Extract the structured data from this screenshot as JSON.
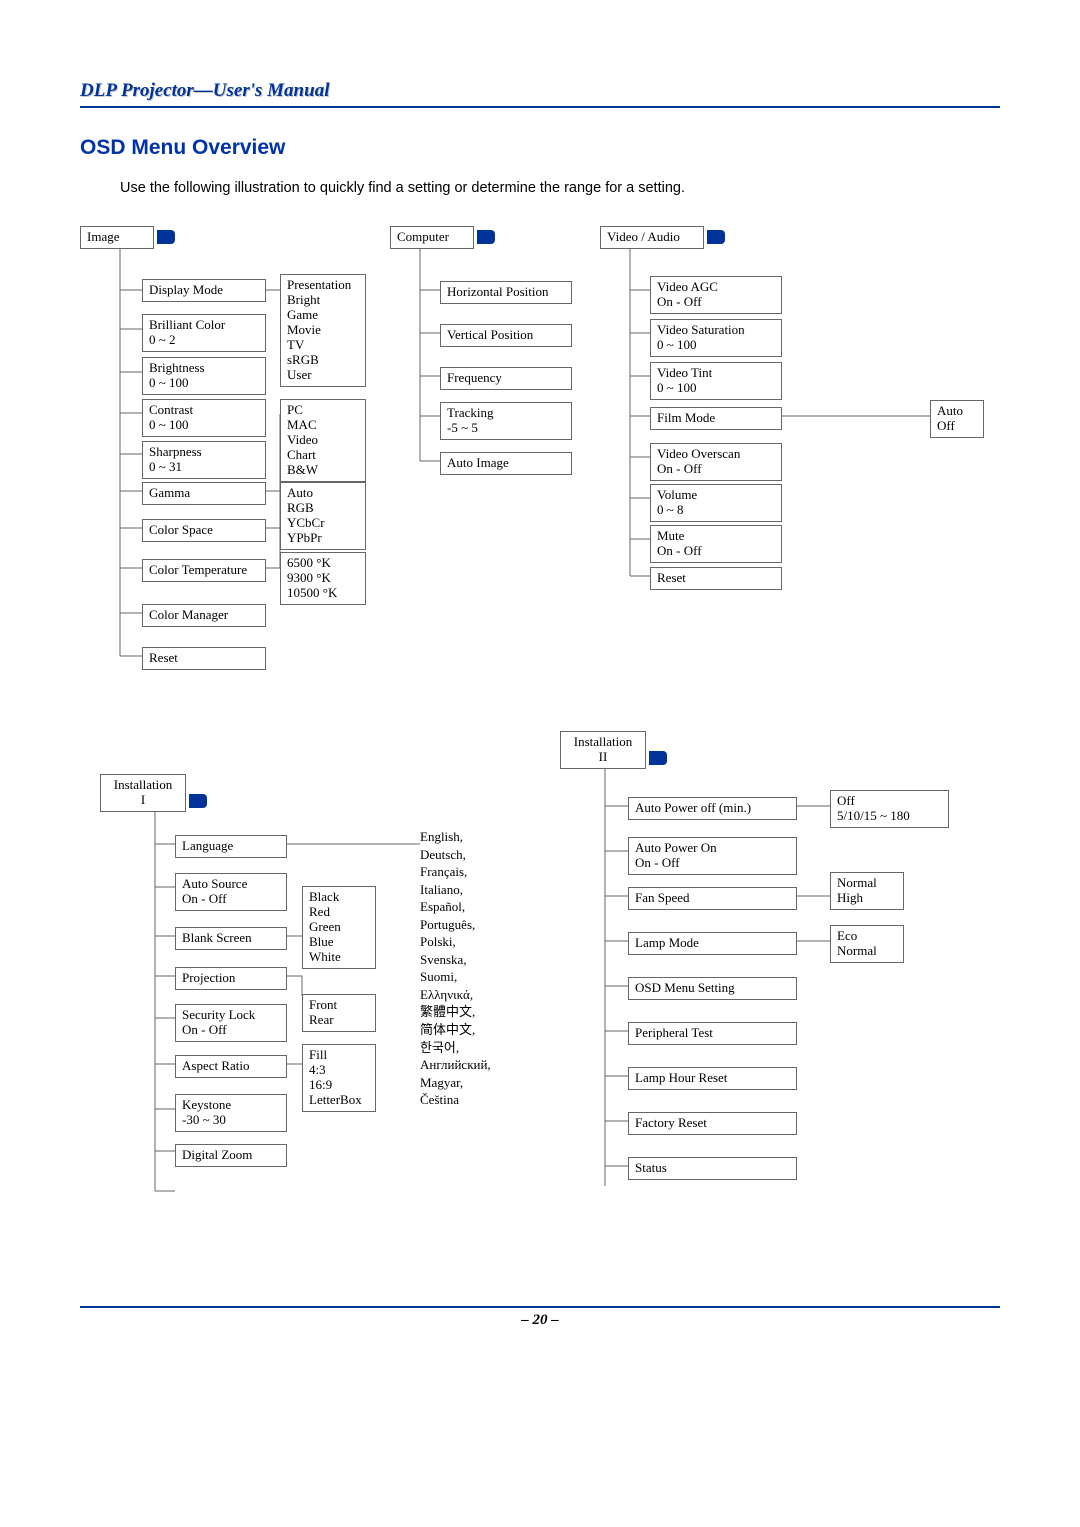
{
  "header": {
    "title": "DLP Projector—User's Manual"
  },
  "section_title": "OSD Menu Overview",
  "intro": "Use the following illustration to quickly find a setting or determine the range for a setting.",
  "page_number": "– 20 –",
  "tabs": {
    "image": "Image",
    "computer": "Computer",
    "video_audio": "Video / Audio",
    "install1": "Installation\nI",
    "install2": "Installation\nII"
  },
  "image_menu": {
    "display_mode": "Display Mode",
    "brilliant_color": "Brilliant Color\n0 ~ 2",
    "brightness": "Brightness\n0 ~ 100",
    "contrast": "Contrast\n0 ~ 100",
    "sharpness": "Sharpness\n0 ~ 31",
    "gamma": "Gamma",
    "color_space": "Color Space",
    "color_temp": "Color Temperature",
    "color_manager": "Color Manager",
    "reset": "Reset",
    "display_mode_vals": "Presentation\nBright\nGame\nMovie\nTV\nsRGB\nUser",
    "gamma_vals": "PC\nMAC\nVideo\nChart\nB&W",
    "color_space_vals": "Auto\nRGB\nYCbCr\nYPbPr",
    "color_temp_vals": "6500 °K\n9300 °K\n10500 °K"
  },
  "computer_menu": {
    "h_pos": "Horizontal Position",
    "v_pos": "Vertical Position",
    "frequency": "Frequency",
    "tracking": "Tracking\n-5 ~ 5",
    "auto_image": "Auto Image"
  },
  "video_menu": {
    "video_agc": "Video AGC\nOn - Off",
    "video_sat": "Video Saturation\n0 ~ 100",
    "video_tint": "Video Tint\n0 ~ 100",
    "film_mode": "Film Mode",
    "film_mode_vals": "Auto\nOff",
    "video_overscan": "Video Overscan\nOn - Off",
    "volume": "Volume\n0 ~ 8",
    "mute": "Mute\nOn - Off",
    "reset": "Reset"
  },
  "install1_menu": {
    "language": "Language",
    "auto_source": "Auto Source\nOn - Off",
    "blank_screen": "Blank Screen",
    "projection": "Projection",
    "security_lock": "Security Lock\nOn - Off",
    "aspect_ratio": "Aspect Ratio",
    "keystone": "Keystone\n-30 ~ 30",
    "digital_zoom": "Digital Zoom",
    "blank_vals": "Black\nRed\nGreen\nBlue\nWhite",
    "proj_vals": "Front\nRear",
    "aspect_vals": "Fill\n4:3\n16:9\nLetterBox",
    "lang_vals": "English,\nDeutsch,\nFrançais,\nItaliano,\nEspañol,\nPortuguês,\nPolski,\nSvenska,\nSuomi,\nΕλληνικά,\n繁體中文,\n简体中文,\n한국어,\nАнглийский,\nMagyar,\nČeština"
  },
  "install2_menu": {
    "auto_power_off": "Auto Power off (min.)",
    "auto_power_off_vals": "Off\n5/10/15 ~ 180",
    "auto_power_on": "Auto Power On\nOn - Off",
    "fan_speed": "Fan Speed",
    "fan_speed_vals": "Normal\nHigh",
    "lamp_mode": "Lamp Mode",
    "lamp_mode_vals": "Eco\nNormal",
    "osd_menu": "OSD Menu Setting",
    "peripheral": "Peripheral Test",
    "lamp_hour_reset": "Lamp Hour Reset",
    "factory_reset": "Factory Reset",
    "status": "Status"
  }
}
